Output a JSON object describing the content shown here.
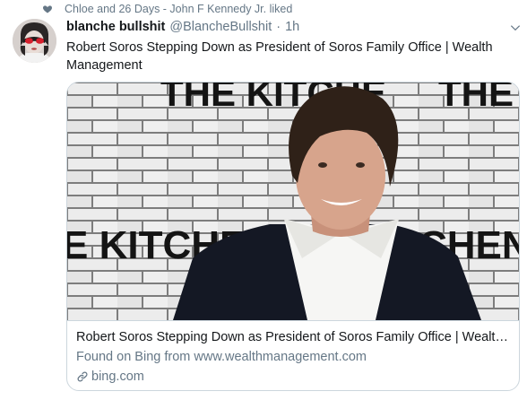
{
  "social_context": {
    "icon": "heart-icon",
    "text": "Chloe and 26 Days - John F Kennedy Jr. liked"
  },
  "tweet": {
    "author_name": "blanche bullshit",
    "handle": "@BlancheBullshit",
    "separator": "·",
    "time": "1h",
    "text": "Robert Soros Stepping Down as President of Soros Family Office | Wealth Management",
    "menu_icon": "chevron-down-icon"
  },
  "card": {
    "image_text_top_left": "THE KITCHE",
    "image_text_top_right": "THE K",
    "image_text_bottom_left": "E KITCHEN",
    "image_text_bottom_right": "CHEN",
    "title": "Robert Soros Stepping Down as President of Soros Family Office | Wealth Management",
    "description": "Found on Bing from www.wealthmanagement.com",
    "domain_icon": "link-icon",
    "domain": "bing.com"
  },
  "colors": {
    "secondary_text": "#657786",
    "primary_text": "#14171a",
    "border": "#ccd6dd"
  }
}
